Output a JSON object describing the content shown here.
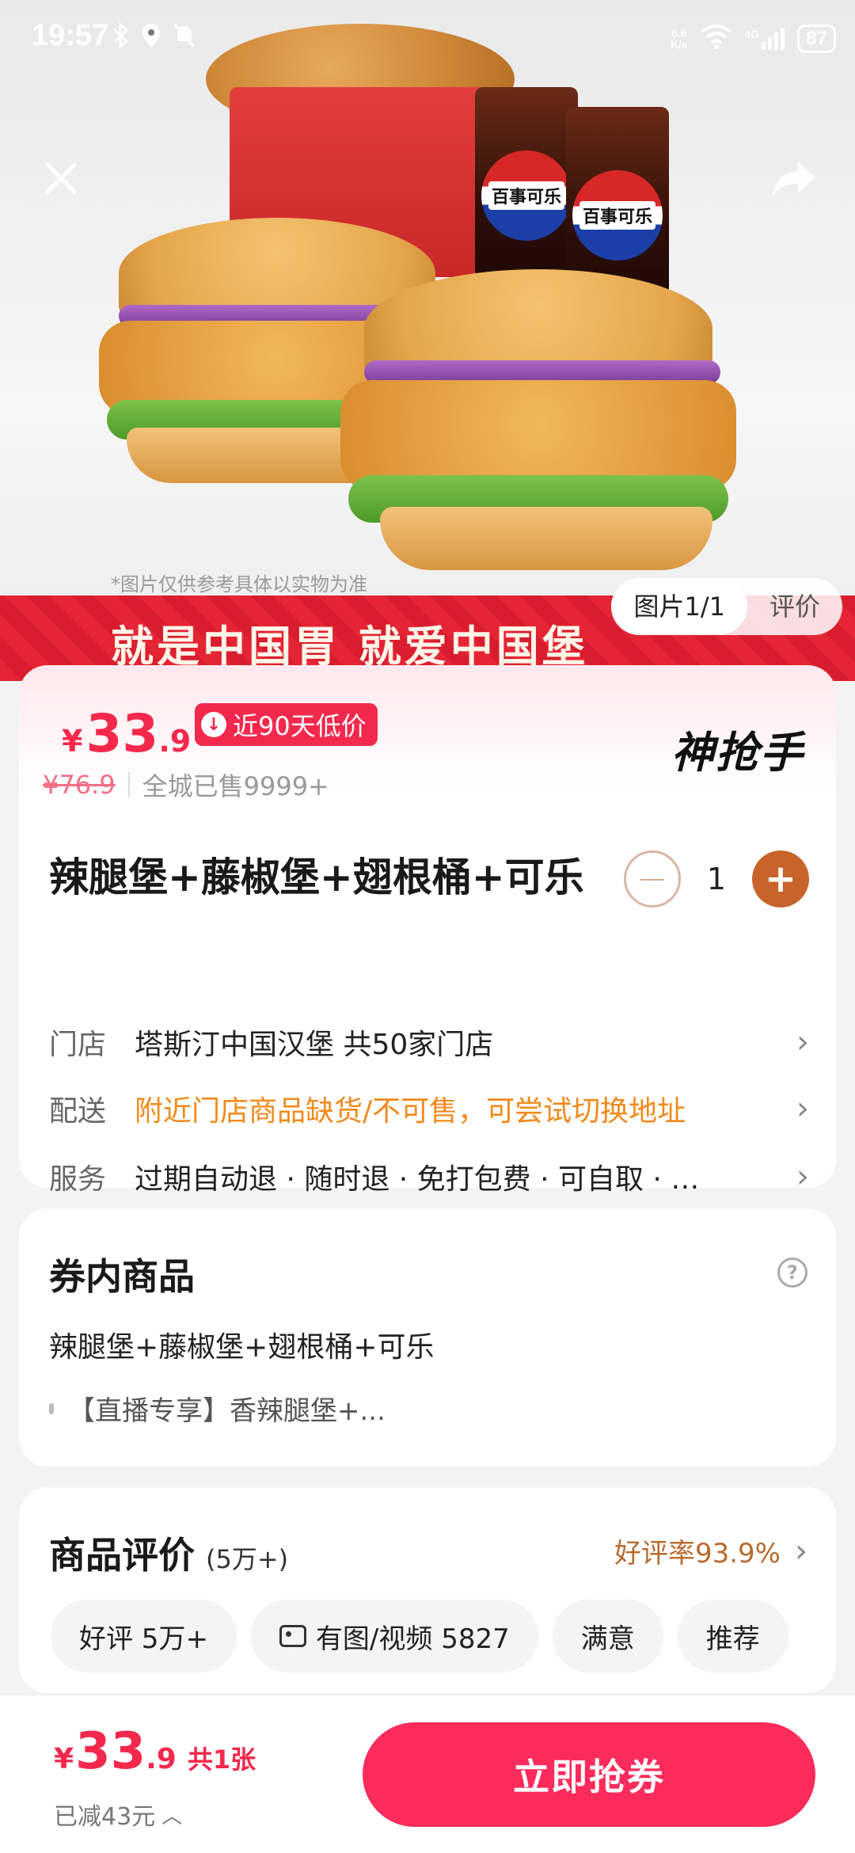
{
  "status_bar": {
    "time": "19:57",
    "net_speed_value": "6.6",
    "net_speed_unit": "K/s",
    "signal_label": "4G",
    "battery": "87"
  },
  "hero": {
    "disclaimer": "*图片仅供参考具体以实物为准",
    "banner_text": "就是中国胃 就爱中国堡",
    "cup_label": "百事可乐",
    "tabs": [
      "图片1/1",
      "评价"
    ]
  },
  "product": {
    "price_symbol": "¥",
    "price_int": "33",
    "price_dec": ".9",
    "low_price_badge": "近90天低价",
    "brand": "神抢手",
    "original_price": "¥76.9",
    "sold_text": "全城已售9999+",
    "title": "辣腿堡+藤椒堡+翅根桶+可乐",
    "quantity": "1",
    "minus_symbol": "−",
    "plus_symbol": "+"
  },
  "info_rows": {
    "store_label": "门店",
    "store_value": "塔斯汀中国汉堡  共50家门店",
    "delivery_label": "配送",
    "delivery_value": "附近门店商品缺货/不可售，可尝试切换地址",
    "service_label": "服务",
    "service_value": "过期自动退 · 随时退 · 免打包费 · 可自取 · …",
    "chevron": "›"
  },
  "voucher_items": {
    "heading": "券内商品",
    "help_symbol": "?",
    "item": "辣腿堡+藤椒堡+翅根桶+可乐",
    "sub_item": "【直播专享】香辣腿堡+..."
  },
  "reviews": {
    "heading": "商品评价",
    "count": "(5万+)",
    "rating": "好评率93.9%",
    "chips": [
      "好评  5万+",
      "有图/视频  5827",
      "满意",
      "推荐"
    ]
  },
  "bottom_bar": {
    "price_symbol": "¥",
    "price_int": "33",
    "price_dec": ".9",
    "count_text": "共1张",
    "saved_text": "已减43元",
    "buy_label": "立即抢券"
  },
  "colors": {
    "accent": "#f2294d",
    "buy_button": "#fb2b5c",
    "stepper_plus": "#c8642a",
    "delivery_warning": "#f08a1c",
    "rating": "#b86a2c"
  },
  "icons": [
    "bluetooth-icon",
    "location-icon",
    "mute-icon",
    "wifi-icon",
    "cellular-signal-icon",
    "battery-icon",
    "close-icon",
    "share-icon",
    "price-down-icon",
    "chevron-right-icon",
    "help-icon",
    "image-icon",
    "chevron-up-icon"
  ]
}
